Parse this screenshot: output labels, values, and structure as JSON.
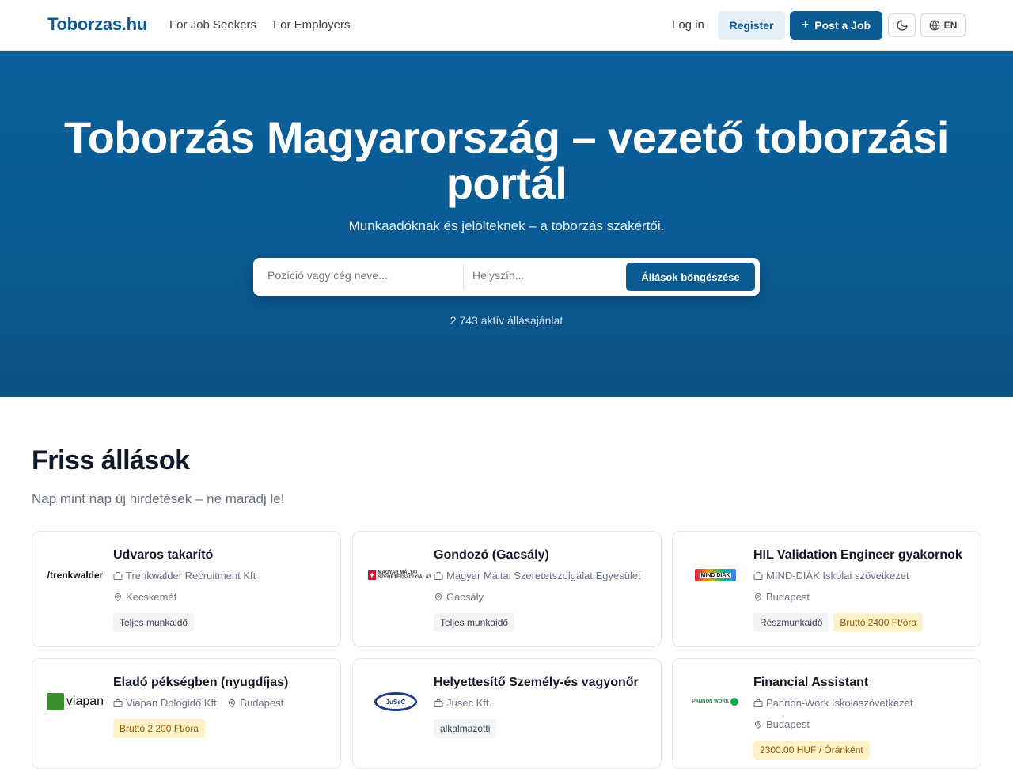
{
  "header": {
    "logo": "Toborzas.hu",
    "nav": {
      "seekers": "For Job Seekers",
      "employers": "For Employers"
    },
    "login": "Log in",
    "register": "Register",
    "post_job": "Post a Job",
    "lang": "EN"
  },
  "hero": {
    "title": "Toborzás Magyarország – vezető toborzási portál",
    "subtitle": "Munkaadóknak és jelölteknek – a toborzás szakértői.",
    "search_placeholder": "Pozíció vagy cég neve...",
    "location_placeholder": "Helyszín...",
    "search_button": "Állások böngészése",
    "job_count": "2 743 aktív állásajánlat"
  },
  "section": {
    "title": "Friss állások",
    "subtitle": "Nap mint nap új hirdetések – ne maradj le!"
  },
  "jobs": [
    {
      "title": "Udvaros takarító",
      "company": "Trenkwalder Recruitment Kft",
      "location": "Kecskemét",
      "tags": [
        "Teljes munkaidő"
      ],
      "logo_text": "/trenkwalder"
    },
    {
      "title": "Gondozó (Gacsály)",
      "company": "Magyar Máltai Szeretetszolgálat Egyesület",
      "location": "Gacsály",
      "tags": [
        "Teljes munkaidő"
      ],
      "logo_text": "MAGYAR MÁLTAI SZERETETSZOLGÁLAT"
    },
    {
      "title": "HIL Validation Engineer gyakornok",
      "company": "MIND-DIÁK Iskolai szövetkezet",
      "location": "Budapest",
      "tags": [
        "Részmunkaidő",
        "Bruttó 2400 Ft/óra"
      ],
      "logo_text": "MIND DIÁK"
    },
    {
      "title": "Eladó pékségben (nyugdíjas)",
      "company": "Viapan Dologidő Kft.",
      "location": "Budapest",
      "tags": [
        "Bruttó 2 200 Ft/óra"
      ],
      "logo_text": "viapan"
    },
    {
      "title": "Helyettesítő Személy-és vagyonőr",
      "company": "Jusec Kft.",
      "location": "",
      "tags": [
        "alkalmazotti"
      ],
      "logo_text": "JuSeC"
    },
    {
      "title": "Financial Assistant",
      "company": "Pannon-Work Iskolaszövetkezet",
      "location": "Budapest",
      "tags": [
        "2300.00 HUF / Óránként"
      ],
      "logo_text": "PANNON WORK"
    }
  ],
  "colors": {
    "brand": "#0c5a92",
    "pay_tag": "#fdf1c7"
  }
}
